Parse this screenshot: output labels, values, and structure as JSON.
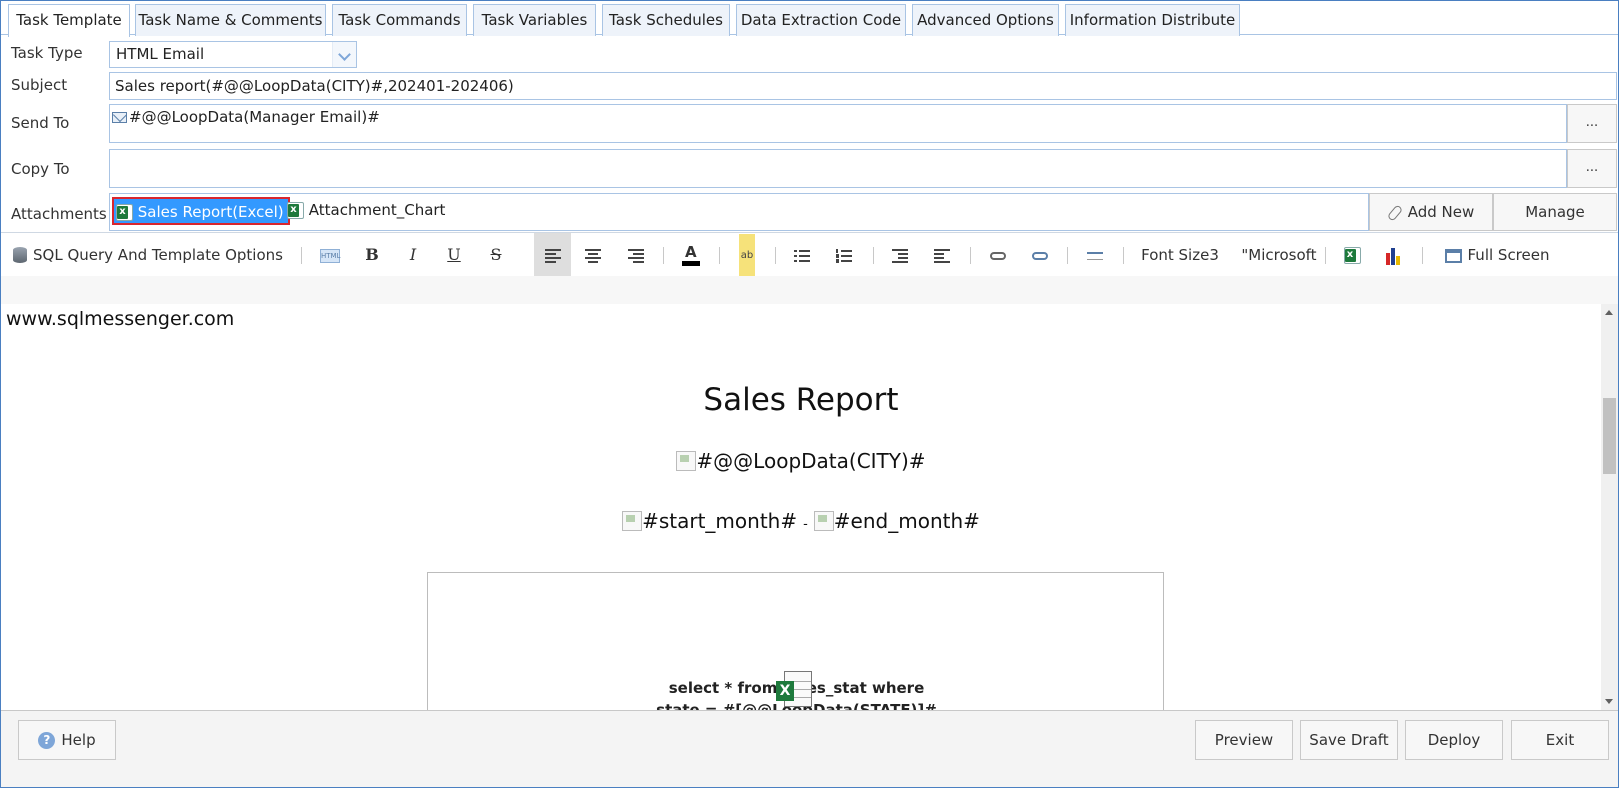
{
  "tabs": [
    {
      "label": "Task Template"
    },
    {
      "label": "Task Name & Comments"
    },
    {
      "label": "Task Commands"
    },
    {
      "label": "Task Variables"
    },
    {
      "label": "Task Schedules"
    },
    {
      "label": "Data Extraction Code"
    },
    {
      "label": "Advanced Options"
    },
    {
      "label": "Information Distribute"
    }
  ],
  "form": {
    "task_type_label": "Task Type",
    "task_type_value": "HTML Email",
    "subject_label": "Subject",
    "subject_value": "Sales report(#@@LoopData(CITY)#,202401-202406)",
    "send_to_label": "Send To",
    "send_to_value": "#@@LoopData(Manager Email)#",
    "copy_to_label": "Copy To",
    "copy_to_value": "",
    "ellipsis": "...",
    "attachments_label": "Attachments",
    "attachments": [
      {
        "name": "Sales Report(Excel)"
      },
      {
        "name": "Attachment_Chart"
      }
    ],
    "add_new": "Add New",
    "manage": "Manage"
  },
  "toolbar": {
    "sql_options": "SQL Query And Template Options",
    "html_label": "HTML",
    "bold": "B",
    "italic": "I",
    "underline": "U",
    "strike": "S",
    "font_color_letter": "A",
    "highlight_label": "ab",
    "font_size": "Font Size3",
    "font_name": "\"Microsoft",
    "full_screen": "Full Screen"
  },
  "editor": {
    "site": "www.sqlmessenger.com",
    "title": "Sales Report",
    "city_line": "#@@LoopData(CITY)#",
    "start_month": "#start_month#",
    "dash": "-",
    "end_month": "#end_month#",
    "sql_line1": "select * from sales_stat where",
    "sql_line2": "state = #[@@LoopData(STATE)]#"
  },
  "footer": {
    "help": "Help",
    "help_symbol": "?",
    "preview": "Preview",
    "save_draft": "Save Draft",
    "deploy": "Deploy",
    "exit": "Exit"
  },
  "colors": {
    "border_blue": "#a9c4e4",
    "selected_attachment": "#3399ff",
    "selected_outline": "#d9262e",
    "excel_green": "#1e7a3c"
  }
}
